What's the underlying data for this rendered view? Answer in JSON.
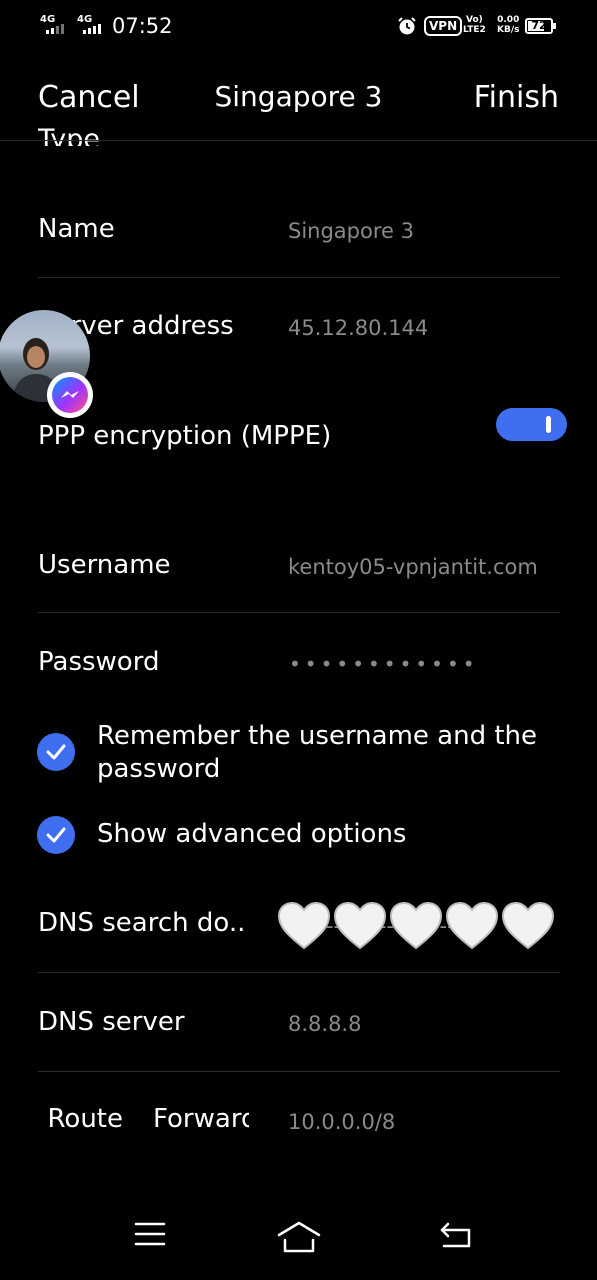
{
  "status_bar": {
    "net1": "4G",
    "net2": "4G",
    "time": "07:52",
    "vpn": "VPN",
    "volte_top": "Vo)",
    "volte_bottom": "LTE2",
    "speed_top": "0.00",
    "speed_bottom": "KB/s",
    "battery": "72",
    "battery_level": 0.72
  },
  "header": {
    "cancel": "Cancel",
    "title": "Singapore 3",
    "finish": "Finish"
  },
  "form": {
    "type_label": "Type",
    "name_label": "Name",
    "name_value": "Singapore 3",
    "server_label": "Server address",
    "server_value": "45.12.80.144",
    "mppe_label": "PPP encryption (MPPE)",
    "mppe_on": true,
    "username_label": "Username",
    "username_value": "kentoy05-vpnjantit.com",
    "password_label": "Password",
    "password_value": "••••••••••••",
    "remember_label": "Remember the username and the password",
    "remember_checked": true,
    "advanced_label": "Show advanced options",
    "advanced_checked": true,
    "dns_search_label": "DNS search do..",
    "dns_search_value": "-----------------------c",
    "dns_server_label": "DNS server",
    "dns_server_value": "8.8.8.8",
    "route_label": "Route",
    "forward_label": "Forward",
    "route_value": "10.0.0.0/8"
  },
  "overlay": {
    "chat_head": "messenger-chat-head",
    "hearts": [
      "white-heart",
      "white-heart",
      "white-heart",
      "white-heart",
      "white-heart"
    ]
  },
  "nav": {
    "icons": [
      "menu-icon",
      "home-icon",
      "back-icon"
    ]
  }
}
